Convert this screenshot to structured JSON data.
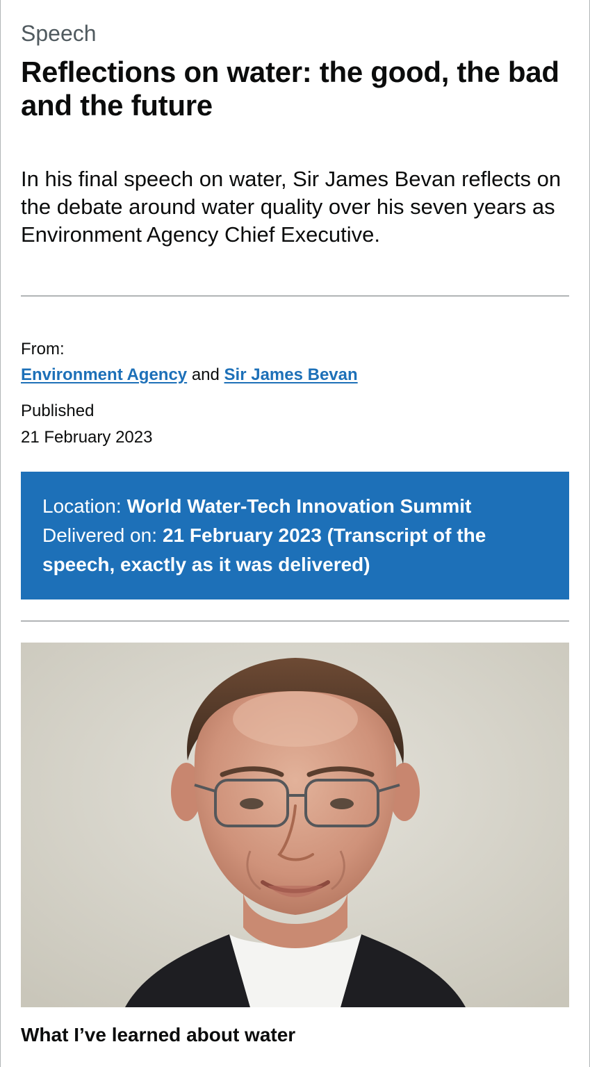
{
  "header": {
    "caption": "Speech",
    "title": "Reflections on water: the good, the bad and the future"
  },
  "summary": "In his final speech on water, Sir James Bevan reflects on the debate around water quality over his seven years as Environment Agency Chief Executive.",
  "metadata": {
    "from_label": "From:",
    "from_links": [
      {
        "label": "Environment Agency"
      },
      {
        "label": "Sir James Bevan"
      }
    ],
    "from_separator": "and",
    "published_label": "Published",
    "published_date": "21 February 2023"
  },
  "speech_info": {
    "location_label": "Location:",
    "location_value": "World Water-Tech Innovation Summit",
    "delivered_label": "Delivered on:",
    "delivered_value": "21 February 2023 (Transcript of the speech, exactly as it was delivered)"
  },
  "image": {
    "alt": "Sir James Bevan",
    "icon": "portrait-photo"
  },
  "section": {
    "heading": "What I’ve learned about water"
  },
  "colors": {
    "link": "#1d70b8",
    "info_box_bg": "#1d70b8",
    "text": "#0b0c0c",
    "secondary_text": "#505a5f",
    "rule": "#b1b4b6"
  }
}
